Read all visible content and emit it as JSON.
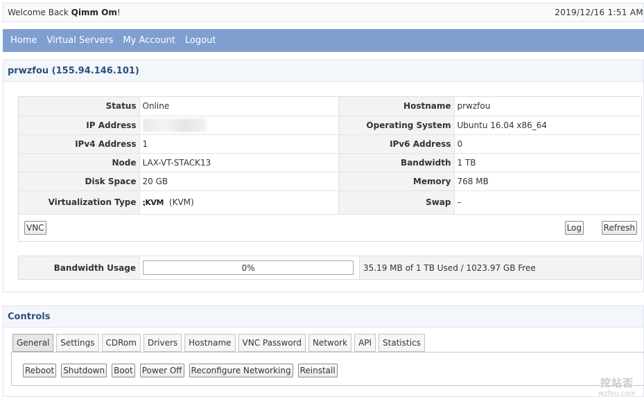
{
  "topbar": {
    "welcome_prefix": "Welcome Back ",
    "username": "Qimm Om",
    "welcome_suffix": "!",
    "datetime": "2019/12/16 1:51 AM"
  },
  "nav": {
    "items": [
      "Home",
      "Virtual Servers",
      "My Account",
      "Logout"
    ]
  },
  "server": {
    "title": "prwzfou (155.94.146.101)",
    "rows": [
      {
        "l1": "Status",
        "v1": "Online",
        "l2": "Hostname",
        "v2": "prwzfou"
      },
      {
        "l1": "IP Address",
        "v1": "",
        "l2": "Operating System",
        "v2": "Ubuntu 16.04 x86_64"
      },
      {
        "l1": "IPv4 Address",
        "v1": "1",
        "l2": "IPv6 Address",
        "v2": "0"
      },
      {
        "l1": "Node",
        "v1": "LAX-VT-STACK13",
        "l2": "Bandwidth",
        "v2": "1 TB"
      },
      {
        "l1": "Disk Space",
        "v1": "20 GB",
        "l2": "Memory",
        "v2": "768 MB"
      },
      {
        "l1": "Virtualization Type",
        "v1_logo": "KVM",
        "v1": "(KVM)",
        "l2": "Swap",
        "v2": "–"
      }
    ],
    "vnc_button": "VNC",
    "log_button": "Log",
    "refresh_button": "Refresh"
  },
  "bandwidth": {
    "label": "Bandwidth Usage",
    "percent_text": "0%",
    "percent_value": 0,
    "summary": "35.19 MB of 1 TB Used / 1023.97 GB Free",
    "bar_color": "#7fb24a"
  },
  "controls": {
    "title": "Controls",
    "tabs": [
      "General",
      "Settings",
      "CDRom",
      "Drivers",
      "Hostname",
      "VNC Password",
      "Network",
      "API",
      "Statistics"
    ],
    "active_tab": "General",
    "buttons": [
      "Reboot",
      "Shutdown",
      "Boot",
      "Power Off",
      "Reconfigure Networking",
      "Reinstall"
    ]
  },
  "watermark": {
    "cn": "挖站否",
    "en": "wzfou.com"
  }
}
